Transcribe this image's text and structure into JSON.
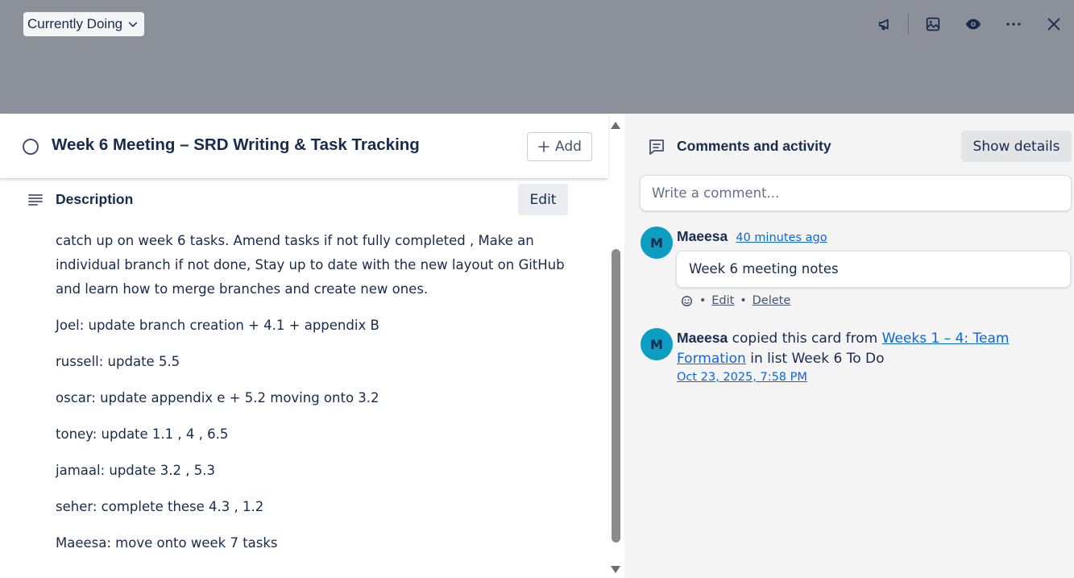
{
  "header": {
    "list_name": "Currently Doing",
    "icons": [
      "megaphone-icon",
      "image-icon",
      "eye-icon",
      "more-icon",
      "close-icon"
    ]
  },
  "card": {
    "title": "Week 6 Meeting – SRD Writing & Task Tracking",
    "add_label": "Add",
    "description_heading": "Description",
    "edit_label": "Edit",
    "description_paragraphs": [
      "catch up on week 6 tasks. Amend tasks if not fully completed , Make an individual branch if not done,  Stay up to date with the new layout on GitHub and learn how to merge branches and create new ones.",
      "Joel: update  branch creation + 4.1 + appendix B",
      "russell: update 5.5",
      "oscar: update appendix e + 5.2  moving onto 3.2",
      "toney:  update 1.1 , 4 , 6.5",
      "jamaal: update 3.2 , 5.3",
      "seher:  complete  these 4.3 , 1.2",
      "Maeesa: move onto week 7 tasks"
    ]
  },
  "comments": {
    "heading": "Comments and activity",
    "show_details_label": "Show details",
    "input_placeholder": "Write a comment...",
    "items": [
      {
        "avatar_initial": "M",
        "author": "Maeesa",
        "time": "40 minutes ago",
        "text": "Week 6 meeting notes",
        "edit_label": "Edit",
        "delete_label": "Delete",
        "separator": "•"
      }
    ],
    "activity": [
      {
        "avatar_initial": "M",
        "author": "Maeesa",
        "action": "copied this card from",
        "source_link": "Weeks 1 – 4: Team Formation",
        "suffix": "in list Week 6 To Do",
        "date": "Oct 23, 2025, 7:58 PM"
      }
    ]
  },
  "colors": {
    "cover": "#8c9099",
    "avatar": "#0c9dc2",
    "link": "#0c66e4",
    "side_panel": "#f4f4f4"
  }
}
